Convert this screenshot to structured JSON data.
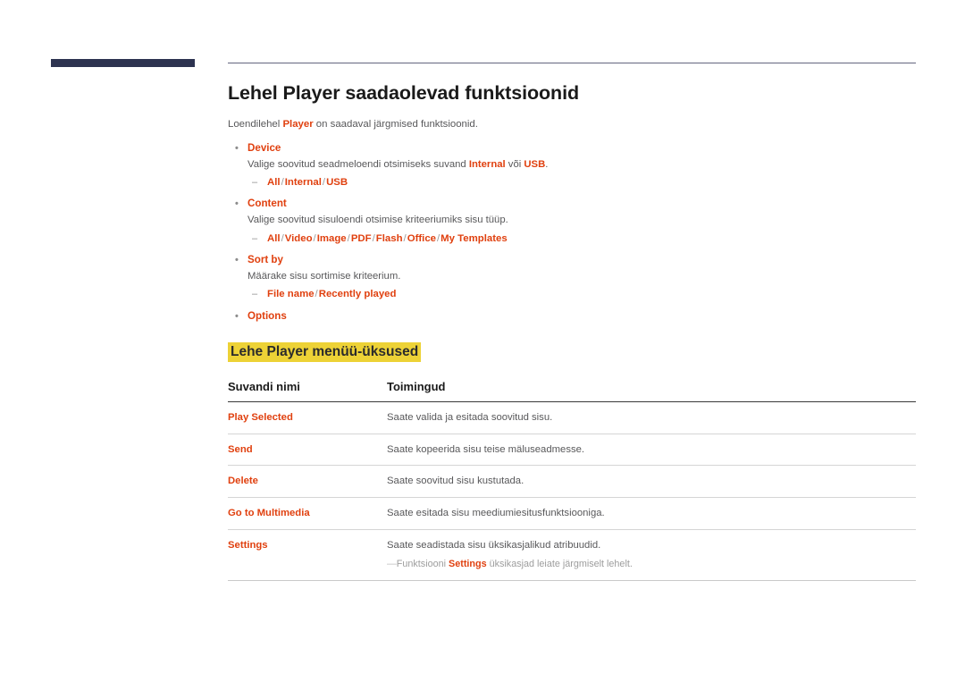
{
  "page": {
    "title": "Lehel Player saadaolevad funktsioonid",
    "intro_prefix": "Loendilehel ",
    "intro_term": "Player",
    "intro_suffix": " on saadaval järgmised funktsioonid.",
    "section_title": "Lehe Player menüü-üksused"
  },
  "colors": {
    "accent_red": "#e0400f",
    "highlight_yellow": "#edd236",
    "navy_bar": "#2d3350",
    "body_text": "#58585a",
    "heading_text": "#1a1a1a"
  },
  "features": [
    {
      "name": "Device",
      "desc_pre": "Valige soovitud seadmeloendi otsimiseks suvand ",
      "desc_term1": "Internal",
      "desc_mid": " või ",
      "desc_term2": "USB",
      "desc_post": ".",
      "options": [
        "All",
        "Internal",
        "USB"
      ]
    },
    {
      "name": "Content",
      "desc_pre": "Valige soovitud sisuloendi otsimise kriteeriumiks sisu tüüp.",
      "desc_term1": "",
      "desc_mid": "",
      "desc_term2": "",
      "desc_post": "",
      "options": [
        "All",
        "Video",
        "Image",
        "PDF",
        "Flash",
        "Office",
        "My Templates"
      ]
    },
    {
      "name": "Sort by",
      "desc_pre": "Määrake sisu sortimise kriteerium.",
      "desc_term1": "",
      "desc_mid": "",
      "desc_term2": "",
      "desc_post": "",
      "options": [
        "File name",
        "Recently played"
      ]
    },
    {
      "name": "Options",
      "desc_pre": "",
      "desc_term1": "",
      "desc_mid": "",
      "desc_term2": "",
      "desc_post": "",
      "options": []
    }
  ],
  "table": {
    "headers": [
      "Suvandi nimi",
      "Toimingud"
    ],
    "rows": [
      {
        "name": "Play Selected",
        "desc": "Saate valida ja esitada soovitud sisu."
      },
      {
        "name": "Send",
        "desc": "Saate kopeerida sisu teise mäluseadmesse."
      },
      {
        "name": "Delete",
        "desc": "Saate soovitud sisu kustutada."
      },
      {
        "name": "Go to Multimedia",
        "desc": "Saate esitada sisu meediumiesitusfunktsiooniga."
      },
      {
        "name": "Settings",
        "desc": "Saate seadistada sisu üksikasjalikud atribuudid.",
        "note_dash": "―",
        "note_pre": "Funktsiooni ",
        "note_term": "Settings",
        "note_post": " üksikasjad leiate järgmiselt lehelt."
      }
    ]
  },
  "symbols": {
    "bullet": "•",
    "sub_dash": "–",
    "slash": "/"
  }
}
